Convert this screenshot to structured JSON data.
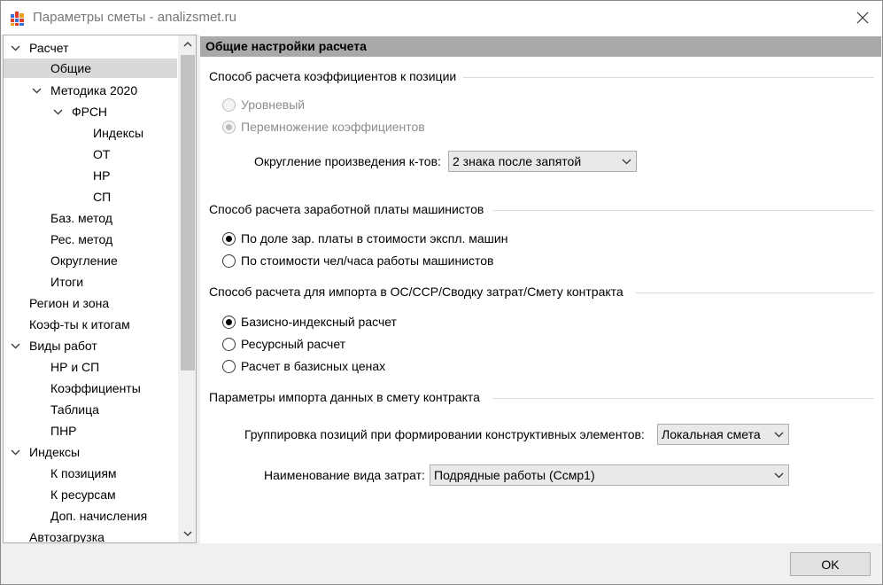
{
  "window": {
    "title": "Параметры сметы - analizsmet.ru",
    "app_icon": "grid-app-icon",
    "close_icon": "close-icon"
  },
  "tree": {
    "items": [
      {
        "label": "Расчет",
        "expanded": true
      },
      {
        "label": "Общие",
        "selected": true
      },
      {
        "label": "Методика 2020",
        "expanded": true
      },
      {
        "label": "ФРСН",
        "expanded": true
      },
      {
        "label": "Индексы"
      },
      {
        "label": "ОТ"
      },
      {
        "label": "НР"
      },
      {
        "label": "СП"
      },
      {
        "label": "Баз. метод"
      },
      {
        "label": "Рес. метод"
      },
      {
        "label": "Округление"
      },
      {
        "label": "Итоги"
      },
      {
        "label": "Регион и зона"
      },
      {
        "label": "Коэф-ты к итогам"
      },
      {
        "label": "Виды работ",
        "expanded": true
      },
      {
        "label": "НР и СП"
      },
      {
        "label": "Коэффициенты"
      },
      {
        "label": "Таблица"
      },
      {
        "label": "ПНР"
      },
      {
        "label": "Индексы",
        "expanded": true
      },
      {
        "label": "К позициям"
      },
      {
        "label": "К ресурсам"
      },
      {
        "label": "Доп. начисления"
      },
      {
        "label": "Автозагрузка"
      }
    ]
  },
  "content": {
    "header": "Общие настройки расчета",
    "group1": {
      "title": "Способ расчета коэффициентов к позиции",
      "options": [
        "Уровневый",
        "Перемножение коэффициентов"
      ],
      "rounding_label": "Округление произведения к-тов:",
      "rounding_value": "2 знака после запятой"
    },
    "group2": {
      "title": "Способ расчета заработной платы машинистов",
      "options": [
        "По доле зар. платы в стоимости экспл. машин",
        "По стоимости чел/часа работы машинистов"
      ]
    },
    "group3": {
      "title": "Способ расчета для импорта в ОС/ССР/Сводку затрат/Смету контракта",
      "options": [
        "Базисно-индексный расчет",
        "Ресурсный расчет",
        "Расчет в базисных ценах"
      ]
    },
    "group4": {
      "title": "Параметры импорта данных в смету контракта",
      "grouping_label": "Группировка позиций при формировании конструктивных элементов:",
      "grouping_value": "Локальная смета",
      "cost_label": "Наименование вида затрат:",
      "cost_value": "Подрядные работы (Ссмр1)"
    }
  },
  "footer": {
    "ok_label": "OK"
  }
}
